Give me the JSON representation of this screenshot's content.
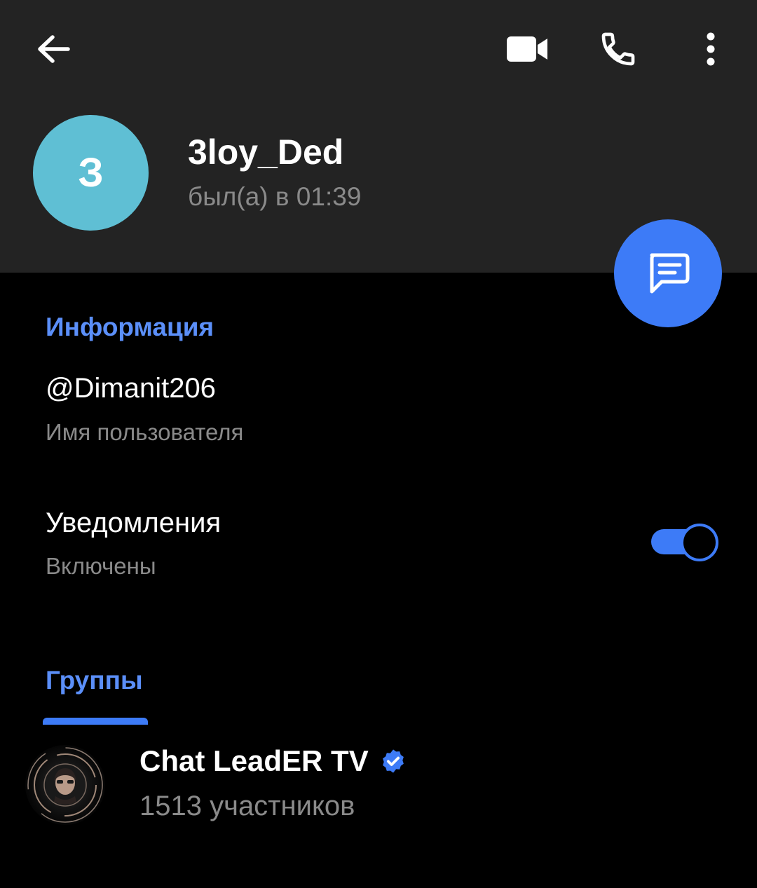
{
  "profile": {
    "avatar_letter": "З",
    "avatar_color": "#5fbfd4",
    "name": "3loy_Ded",
    "status": "был(а) в 01:39"
  },
  "toolbar": {
    "back_icon": "arrow-left-icon",
    "video_icon": "video-camera-icon",
    "call_icon": "phone-icon",
    "more_icon": "more-vertical-icon"
  },
  "fab": {
    "icon": "message-icon"
  },
  "info": {
    "title": "Информация",
    "username": "@Dimanit206",
    "username_caption": "Имя пользователя",
    "notifications_label": "Уведомления",
    "notifications_state": "Включены",
    "notifications_enabled": true
  },
  "groups": {
    "tab_label": "Группы",
    "items": [
      {
        "name": "Chat LeadER TV",
        "verified": true,
        "members": "1513 участников"
      }
    ]
  },
  "colors": {
    "accent": "#3d7bf7",
    "section_title": "#5b8ff9",
    "header_bg": "#232323",
    "background": "#000000",
    "secondary_text": "#8a8a8a"
  }
}
